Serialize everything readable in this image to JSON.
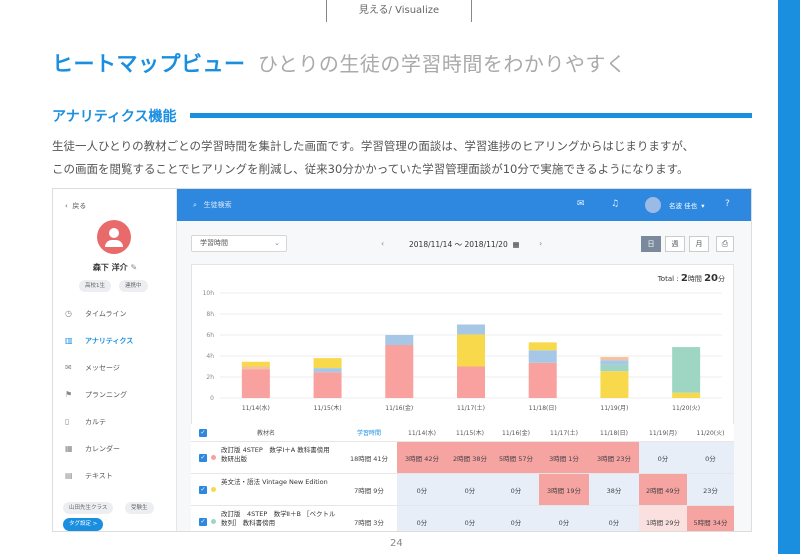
{
  "header_tag": "見える/ Visualize",
  "title": "ヒートマップビュー",
  "subtitle": "ひとりの生徒の学習時間をわかりやすく",
  "section": "アナリティクス機能",
  "description": [
    "生徒一人ひとりの教材ごとの学習時間を集計した画面です。学習管理の面談は、学習進捗のヒアリングからはじまりますが、",
    "この画面を閲覧することでヒアリングを削減し、従来30分かかっていた学習管理面談が10分で実施できるようになります。"
  ],
  "app": {
    "back": "戻る",
    "student_name": "森下 洋介",
    "tags": [
      "高校1生",
      "連携中"
    ],
    "nav": [
      {
        "label": "タイムライン",
        "icon": "clock-icon"
      },
      {
        "label": "アナリティクス",
        "icon": "bar-chart-icon",
        "active": true
      },
      {
        "label": "メッセージ",
        "icon": "mail-icon"
      },
      {
        "label": "プランニング",
        "icon": "flag-icon"
      },
      {
        "label": "カルテ",
        "icon": "clipboard-icon"
      },
      {
        "label": "カレンダー",
        "icon": "calendar-icon"
      },
      {
        "label": "テキスト",
        "icon": "book-icon"
      }
    ],
    "class_tags": [
      "山田先生クラス",
      "受験生"
    ],
    "tag_button": "タグ設定 >",
    "search_placeholder": "生徒検索",
    "user_name": "名波 佳也",
    "select_value": "学習時間",
    "date_range": "2018/11/14 〜 2018/11/20",
    "view_modes": [
      "日",
      "週",
      "月"
    ],
    "active_view": "日",
    "total_label": "Total :",
    "total_hours": "2",
    "total_h_unit": "時間",
    "total_minutes": "20",
    "total_m_unit": "分"
  },
  "chart_data": {
    "type": "bar",
    "stacked": true,
    "categories": [
      "11/14(水)",
      "11/15(木)",
      "11/16(金)",
      "11/17(土)",
      "11/18(日)",
      "11/19(月)",
      "11/20(火)"
    ],
    "y_ticks": [
      "0",
      "2h",
      "4h",
      "6h",
      "8h",
      "10h"
    ],
    "ylim": [
      0,
      10
    ],
    "colors": [
      "#f9a19f",
      "#f9d94c",
      "#a6c8e6",
      "#9fd6c3",
      "#f4c29d"
    ],
    "stacks": [
      [
        {
          "v": 2.75,
          "c": 0
        },
        {
          "v": 0.25,
          "c": 4
        },
        {
          "v": 0.45,
          "c": 1
        }
      ],
      [
        {
          "v": 2.45,
          "c": 0
        },
        {
          "v": 0.4,
          "c": 2
        },
        {
          "v": 0.95,
          "c": 1
        }
      ],
      [
        {
          "v": 5.05,
          "c": 0
        },
        {
          "v": 0.95,
          "c": 2
        }
      ],
      [
        {
          "v": 3.0,
          "c": 0
        },
        {
          "v": 3.05,
          "c": 1
        },
        {
          "v": 0.95,
          "c": 2
        }
      ],
      [
        {
          "v": 3.35,
          "c": 0
        },
        {
          "v": 1.2,
          "c": 2
        },
        {
          "v": 0.75,
          "c": 1
        }
      ],
      [
        {
          "v": 2.55,
          "c": 1
        },
        {
          "v": 0.6,
          "c": 3
        },
        {
          "v": 0.45,
          "c": 2
        },
        {
          "v": 0.3,
          "c": 4
        }
      ],
      [
        {
          "v": 0.5,
          "c": 1
        },
        {
          "v": 4.35,
          "c": 3
        }
      ]
    ]
  },
  "table": {
    "headers": [
      "教材名",
      "学習時間",
      "11/14(水)",
      "11/15(木)",
      "11/16(金)",
      "11/17(土)",
      "11/18(日)",
      "11/19(月)",
      "11/20(火)"
    ],
    "rows": [
      {
        "name": "改訂版 4STEP　数学Ⅰ＋A 教科書傍用 数研出版",
        "total": "18時間 41分",
        "dot": "#f9a19f",
        "cells": [
          "3時間 42分",
          "2時間 38分",
          "5時間 57分",
          "3時間 1分",
          "3時間 23分",
          "0分",
          "0分"
        ]
      },
      {
        "name": "英文法・語法 Vintage New Edition",
        "total": "7時間 9分",
        "dot": "#f9d94c",
        "cells": [
          "0分",
          "0分",
          "0分",
          "3時間 19分",
          "38分",
          "2時間 49分",
          "23分"
        ]
      },
      {
        "name": "改訂版　4STEP　数学Ⅱ＋B ［ベクトル　数列］ 教科書傍用",
        "total": "7時間 3分",
        "dot": "#9fd6c3",
        "cells": [
          "0分",
          "0分",
          "0分",
          "0分",
          "0分",
          "1時間 29分",
          "5時間 34分"
        ]
      }
    ]
  },
  "page_number": "24"
}
